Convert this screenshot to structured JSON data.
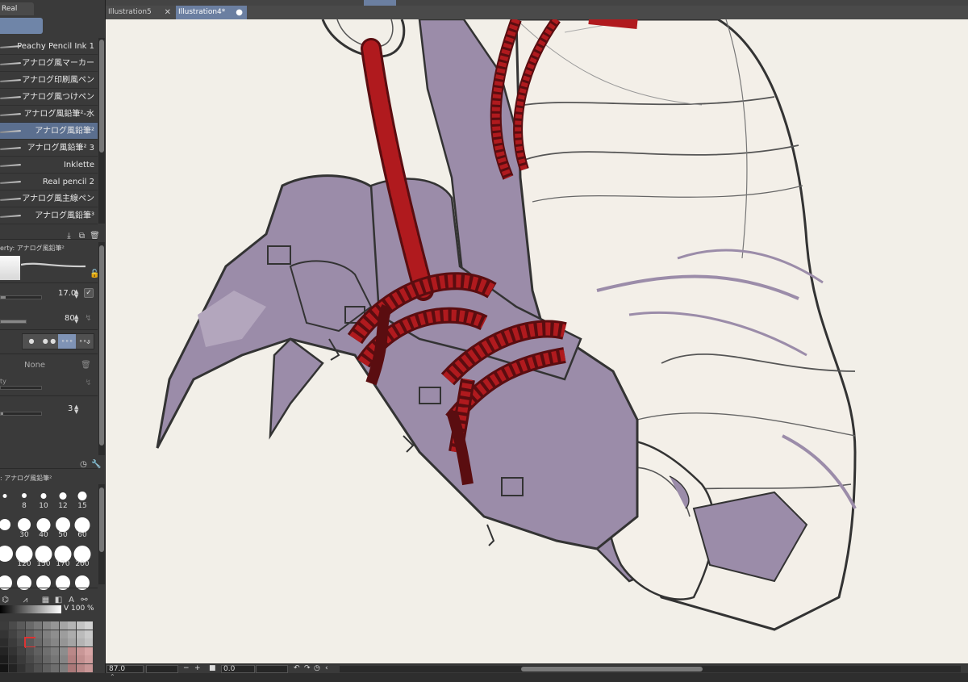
{
  "panel": {
    "tab_label": "Real pencil",
    "brushes": [
      {
        "label": "Peachy Pencil Ink 1",
        "selected": false
      },
      {
        "label": "アナログ風マーカー",
        "selected": false
      },
      {
        "label": "アナログ印刷風ペン",
        "selected": false
      },
      {
        "label": "アナログ風つけペン",
        "selected": false
      },
      {
        "label": "アナログ風鉛筆²-水",
        "selected": false
      },
      {
        "label": "アナログ風鉛筆²",
        "selected": true
      },
      {
        "label": "アナログ風鉛筆² 3",
        "selected": false
      },
      {
        "label": "Inklette",
        "selected": false
      },
      {
        "label": "Real pencil 2",
        "selected": false
      },
      {
        "label": "アナログ風主線ペン",
        "selected": false
      },
      {
        "label": "アナログ風鉛筆³",
        "selected": false
      }
    ]
  },
  "tool_property": {
    "header": "erty: アナログ風鉛筆²",
    "brush_size": "17.0",
    "opacity": "80",
    "texture": "None",
    "texture_label": "ty",
    "stabilization": "3",
    "segment_options": [
      "●",
      "● ●",
      "∘∘∘",
      "∘∘∘"
    ],
    "segment_selected": 2
  },
  "brush_size_panel": {
    "header": ": アナログ風鉛筆²",
    "sizes": [
      "",
      "8",
      "10",
      "12",
      "15",
      "",
      "30",
      "40",
      "50",
      "60",
      "",
      "120",
      "150",
      "170",
      "200",
      "",
      "",
      "",
      "",
      ""
    ]
  },
  "color": {
    "value_label": "V 100 %"
  },
  "document_tabs": [
    {
      "label": "Illustration5",
      "active": false,
      "close": "✕"
    },
    {
      "label": "Illustration4*",
      "active": true,
      "close": "●"
    }
  ],
  "status": {
    "zoom": "87.0",
    "angle": "0.0",
    "minus": "−",
    "plus": "+"
  },
  "colors": {
    "accent": "#6b7fa1",
    "canvas_bg": "#f2efe8",
    "rope": "#a8171b",
    "shadow": "#9c8ca8"
  }
}
